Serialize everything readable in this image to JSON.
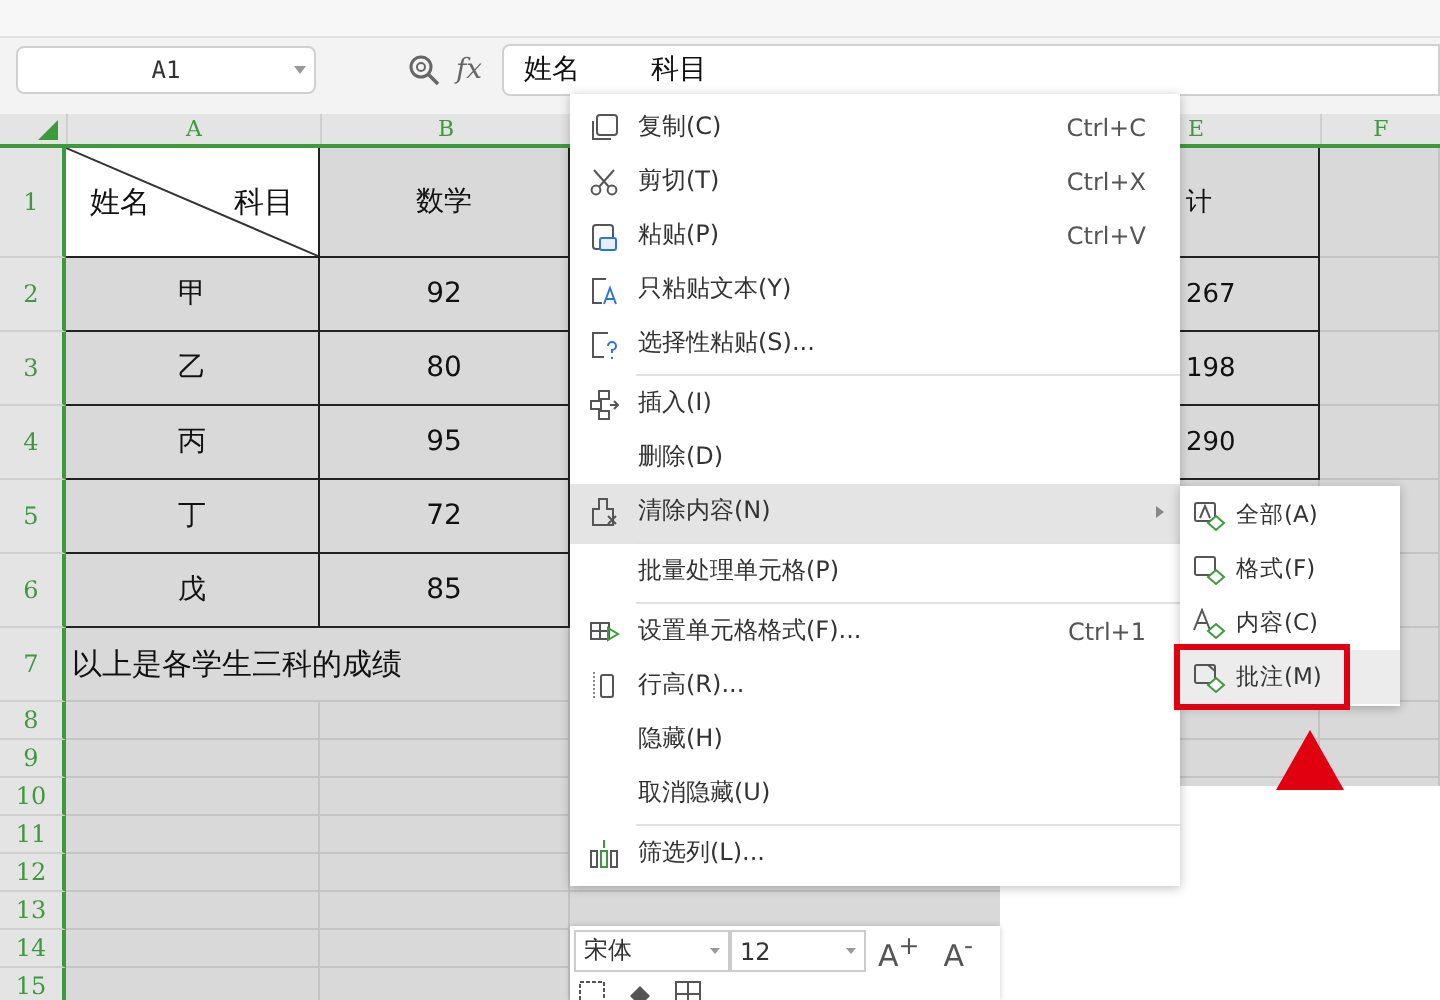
{
  "name_box": {
    "value": "A1"
  },
  "formula_bar": {
    "fx": "fx",
    "value": "姓名        科目"
  },
  "columns": [
    {
      "label": "A"
    },
    {
      "label": "B"
    },
    {
      "label": "E"
    },
    {
      "label": "F"
    }
  ],
  "rows": [
    {
      "label": "1",
      "cells": [
        {
          "kind": "diagonal",
          "left": "姓名",
          "right": "科目"
        },
        {
          "kind": "text",
          "text": "数学"
        },
        {
          "kind": "text",
          "text": "计"
        }
      ]
    },
    {
      "label": "2",
      "cells": [
        {
          "kind": "text",
          "text": "甲"
        },
        {
          "kind": "text",
          "text": "92"
        },
        {
          "kind": "text",
          "text": "267"
        }
      ]
    },
    {
      "label": "3",
      "cells": [
        {
          "kind": "text",
          "text": "乙"
        },
        {
          "kind": "text",
          "text": "80"
        },
        {
          "kind": "text",
          "text": "198"
        }
      ]
    },
    {
      "label": "4",
      "cells": [
        {
          "kind": "text",
          "text": "丙"
        },
        {
          "kind": "text",
          "text": "95"
        },
        {
          "kind": "text",
          "text": "290"
        }
      ]
    },
    {
      "label": "5",
      "cells": [
        {
          "kind": "text",
          "text": "丁"
        },
        {
          "kind": "text",
          "text": "72"
        }
      ]
    },
    {
      "label": "6",
      "cells": [
        {
          "kind": "text",
          "text": "戊"
        },
        {
          "kind": "text",
          "text": "85"
        }
      ]
    },
    {
      "label": "7",
      "cells": [
        {
          "kind": "note",
          "text": "以上是各学生三科的成绩"
        }
      ]
    },
    {
      "label": "8"
    },
    {
      "label": "9"
    },
    {
      "label": "10"
    },
    {
      "label": "11"
    },
    {
      "label": "12"
    },
    {
      "label": "13"
    },
    {
      "label": "14"
    },
    {
      "label": "15"
    }
  ],
  "context_menu": [
    {
      "kind": "copy",
      "label": "复制(C)",
      "shortcut": "Ctrl+C",
      "selected": false,
      "has_submenu": false,
      "divider_after": false
    },
    {
      "kind": "cut",
      "label": "剪切(T)",
      "shortcut": "Ctrl+X",
      "selected": false,
      "has_submenu": false,
      "divider_after": false
    },
    {
      "kind": "paste",
      "label": "粘贴(P)",
      "shortcut": "Ctrl+V",
      "selected": false,
      "has_submenu": false,
      "divider_after": false
    },
    {
      "kind": "paste-text",
      "label": "只粘贴文本(Y)",
      "selected": false,
      "has_submenu": false,
      "divider_after": false
    },
    {
      "kind": "paste-special",
      "label": "选择性粘贴(S)...",
      "selected": false,
      "has_submenu": false,
      "divider_after": true
    },
    {
      "kind": "insert",
      "label": "插入(I)",
      "selected": false,
      "has_submenu": false,
      "divider_after": false
    },
    {
      "kind": "plain",
      "label": "删除(D)",
      "selected": false,
      "has_submenu": false,
      "divider_after": false
    },
    {
      "kind": "clear",
      "label": "清除内容(N)",
      "selected": true,
      "has_submenu": true,
      "divider_after": true
    },
    {
      "kind": "plain",
      "label": "批量处理单元格(P)",
      "selected": false,
      "has_submenu": false,
      "divider_after": true
    },
    {
      "kind": "format-cells",
      "label": "设置单元格格式(F)...",
      "shortcut": "Ctrl+1",
      "selected": false,
      "has_submenu": false,
      "divider_after": false
    },
    {
      "kind": "row-height",
      "label": "行高(R)...",
      "selected": false,
      "has_submenu": false,
      "divider_after": false
    },
    {
      "kind": "plain",
      "label": "隐藏(H)",
      "selected": false,
      "has_submenu": false,
      "divider_after": false
    },
    {
      "kind": "plain",
      "label": "取消隐藏(U)",
      "selected": false,
      "has_submenu": false,
      "divider_after": true
    },
    {
      "kind": "filter-columns",
      "label": "筛选列(L)...",
      "selected": false,
      "has_submenu": false,
      "divider_after": false
    }
  ],
  "submenu": [
    {
      "kind": "all",
      "label": "全部(A)",
      "selected": false,
      "annotated": false
    },
    {
      "kind": "format",
      "label": "格式(F)",
      "selected": false,
      "annotated": false
    },
    {
      "kind": "content",
      "label": "内容(C)",
      "selected": false,
      "annotated": false
    },
    {
      "kind": "comment",
      "label": "批注(M)",
      "selected": true,
      "annotated": true
    }
  ],
  "mini_toolbar": {
    "font": "宋体",
    "size": "12",
    "grow": "A$^{+}$",
    "shrink": "A$^{-}$"
  }
}
